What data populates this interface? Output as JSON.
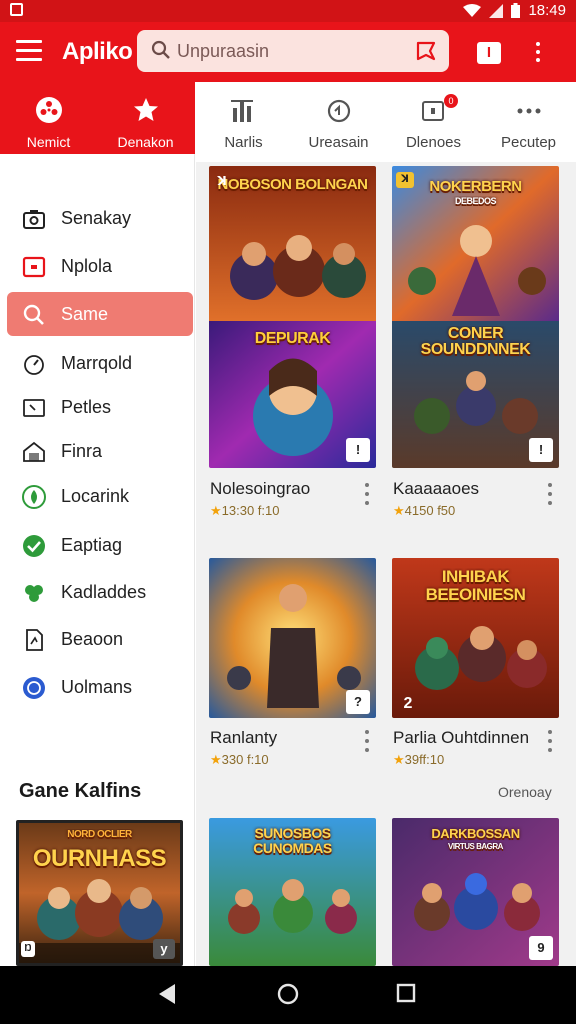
{
  "status_bar": {
    "time": "18:49"
  },
  "app_bar": {
    "title": "Apliko",
    "search_placeholder": "Unpuraasin",
    "bookmark_label": "I"
  },
  "left_categories": [
    {
      "icon": "film-reel-icon",
      "label": "Nemict"
    },
    {
      "icon": "star-icon",
      "label": "Denakon"
    }
  ],
  "top_tabs": [
    {
      "icon": "bar-chart-icon",
      "label": "Narlis"
    },
    {
      "icon": "refresh-icon",
      "label": "Ureasain"
    },
    {
      "icon": "notification-icon",
      "label": "Dlenoes",
      "badge": "0"
    },
    {
      "icon": "more-horizontal-icon",
      "label": "Pecutep"
    }
  ],
  "sidebar": {
    "items": [
      {
        "icon": "camera-icon",
        "label": "Senakay"
      },
      {
        "icon": "tv-icon",
        "label": "Nplola"
      },
      {
        "icon": "search-icon",
        "label": "Same",
        "active": true
      },
      {
        "icon": "speedometer-icon",
        "label": "Marrqold"
      },
      {
        "icon": "picture-icon",
        "label": "Petles"
      },
      {
        "icon": "house-icon",
        "label": "Finra"
      },
      {
        "icon": "leaf-icon",
        "label": "Locarink"
      },
      {
        "icon": "check-circle-icon",
        "label": "Eaptiag"
      },
      {
        "icon": "clover-icon",
        "label": "Kadladdes"
      },
      {
        "icon": "doc-icon",
        "label": "Beaoon"
      },
      {
        "icon": "globe-icon",
        "label": "Uolmans"
      }
    ],
    "section_title": "Gane Kalfins",
    "featured_card": {
      "art_title": "OURNHASS",
      "art_subtitle": "NORD OCLIER",
      "corner_label": "y",
      "corner_left": "Ŋ"
    }
  },
  "games": [
    {
      "art_title": "NOBOSON BOLNGAN",
      "corner_left": "ꓘ",
      "art_title2": "DEPURAK",
      "name": "Nolesoingrao",
      "rating": "13:30 f:10",
      "corner_label": "!"
    },
    {
      "art_title": "NOKERBERN",
      "art_sub": "DEBEDOS",
      "art_title2": "CONER SOUNDDNNEK",
      "name": "Kaaaaaoes",
      "rating": "4150 f50",
      "corner_label": "!"
    },
    {
      "art_title": "",
      "name": "Ranlanty",
      "rating": "330 f:10",
      "corner_label": "?"
    },
    {
      "art_title": "INHIBAK BEEOINIESN",
      "name": "Parlia Ouhtdinnen",
      "rating": "39ff:10",
      "corner_label": "",
      "corner_number": "2"
    },
    {
      "art_title": "SUNOSBOS CUNOMDAS",
      "name": "",
      "rating": "",
      "corner_label": ""
    },
    {
      "art_title": "DARKBOSSAN",
      "art_sub": "VIRTUS BAGRA",
      "name": "",
      "rating": "",
      "corner_label": "9"
    }
  ],
  "see_more_label": "Orenoay",
  "colors": {
    "brand_red": "#e8141a",
    "active_item": "#ef7b72",
    "rating_star": "#f2a20b"
  }
}
